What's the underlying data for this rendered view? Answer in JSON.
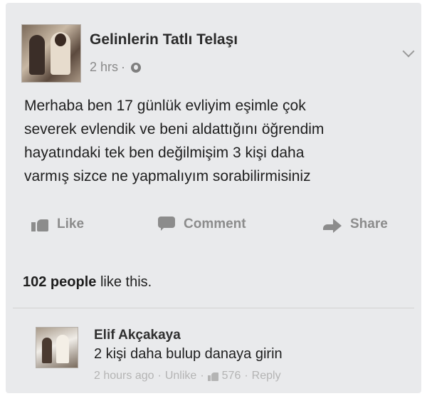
{
  "post": {
    "page_name": "Gelinlerin Tatlı Telaşı",
    "time": "2 hrs",
    "separator": "·",
    "audience_icon": "globe-icon",
    "text": "Merhaba ben 17 günlük evliyim eşimle çok\nseverek evlendik ve beni aldattığını öğrendim\nhayatındaki tek ben değilmişim 3 kişi daha\nvarmış sizce ne yapmalıyım sorabilirmisiniz"
  },
  "actions": {
    "like": "Like",
    "comment": "Comment",
    "share": "Share"
  },
  "likes": {
    "count": "102 people",
    "suffix": " like this."
  },
  "comment": {
    "author": "Elif Akçakaya",
    "text": "2 kişi daha bulup danaya girin",
    "time": "2 hours ago",
    "dot1": "·",
    "unlike": "Unlike",
    "dot2": "·",
    "like_count": "576",
    "dot3": "·",
    "reply": "Reply"
  },
  "colors": {
    "background": "#e9eaec",
    "text": "#1e1e1e",
    "muted": "#8c8c8c"
  }
}
